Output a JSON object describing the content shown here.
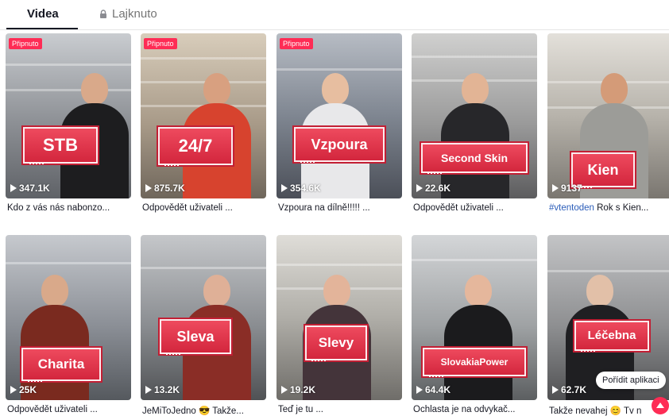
{
  "tabs": {
    "videos": "Videa",
    "liked": "Lajknuto"
  },
  "pinned_label": "Připnuto",
  "videos": [
    {
      "label": "STB",
      "views": "347.1K",
      "caption": "Kdo z vás nás nabonzo...",
      "pinned": true,
      "theme": "#8c8f94",
      "skin": "#d9a98a",
      "shirt": "#1d1d1f"
    },
    {
      "label": "24/7",
      "views": "875.7K",
      "caption": "Odpovědět uživateli ...",
      "pinned": true,
      "theme": "#a89a88",
      "skin": "#d8a080",
      "shirt": "#d7432e"
    },
    {
      "label": "Vzpoura",
      "views": "354.6K",
      "caption": "Vzpoura na dílně!!!!! ...",
      "pinned": true,
      "theme": "#7f8691",
      "skin": "#e7bea0",
      "shirt": "#e8e8ea"
    },
    {
      "label": "Second Skin",
      "views": "22.6K",
      "caption": "Odpovědět uživateli ...",
      "pinned": false,
      "theme": "#9a9a9a",
      "skin": "#e2b495",
      "shirt": "#27272a"
    },
    {
      "label": "Kien",
      "views": "9137",
      "caption": "Rok s Kien...",
      "hashtag": "#vtentoden",
      "pinned": false,
      "theme": "#b7b3ab",
      "skin": "#d49b78",
      "shirt": "#9c9c98"
    },
    {
      "label": "Charita",
      "views": "25K",
      "caption": "Odpovědět uživateli ...",
      "pinned": false,
      "theme": "#8b8f96",
      "skin": "#d9a98a",
      "shirt": "#7a2a1f"
    },
    {
      "label": "Sleva",
      "views": "13.2K",
      "caption": "JeMiToJedno 😎 Takže...",
      "pinned": false,
      "theme": "#8a8d91",
      "skin": "#dfb097",
      "shirt": "#8a2d26"
    },
    {
      "label": "Slevy",
      "views": "19.2K",
      "caption": "Teď je tu ...",
      "pinned": false,
      "theme": "#b0aea8",
      "skin": "#e3b49a",
      "shirt": "#44343a"
    },
    {
      "label": "SlovakiaPower",
      "views": "64.4K",
      "caption": "Ochlasta je na odvykač...",
      "pinned": false,
      "theme": "#9fa2a4",
      "skin": "#e5b79c",
      "shirt": "#1b1b1d"
    },
    {
      "label": "Léčebna",
      "views": "62.7K",
      "caption": "Takže nevahej 😊 Tv n",
      "pinned": false,
      "theme": "#8e8f91",
      "skin": "#e2c0a8",
      "shirt": "#1f1f22"
    }
  ],
  "open_app_label": "Pořídit aplikaci",
  "colors": {
    "accent": "#fe2c55",
    "banner": "#e03a50"
  }
}
